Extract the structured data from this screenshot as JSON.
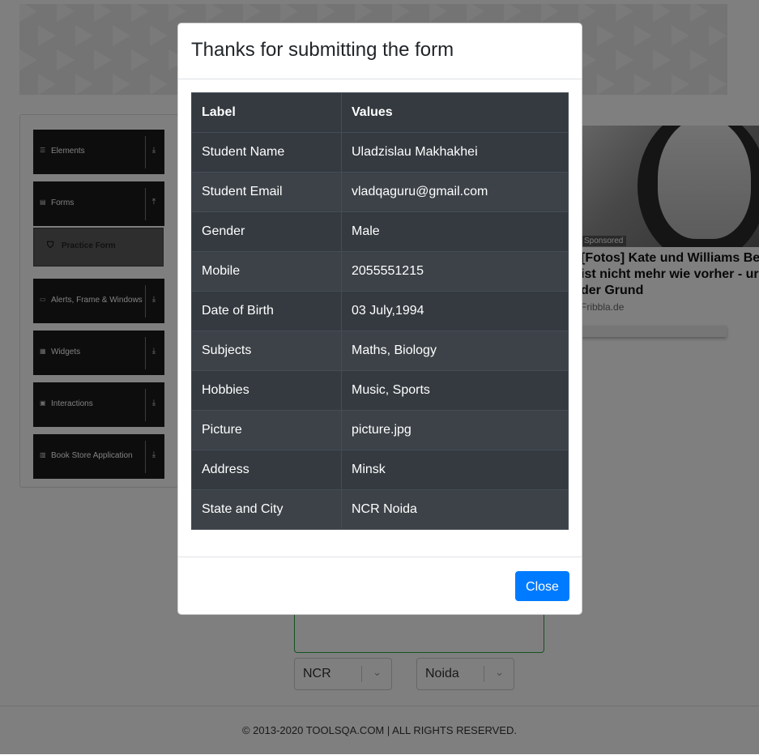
{
  "sidebar": {
    "groups": [
      {
        "label": "Elements",
        "icon": "list-icon"
      },
      {
        "label": "Forms",
        "icon": "document-icon"
      },
      {
        "label": "Alerts, Frame & Windows",
        "icon": "window-icon"
      },
      {
        "label": "Widgets",
        "icon": "grid-icon"
      },
      {
        "label": "Interactions",
        "icon": "interaction-icon"
      },
      {
        "label": "Book Store Application",
        "icon": "books-icon"
      }
    ],
    "active_item": {
      "label": "Practice Form",
      "icon": "html5-icon"
    }
  },
  "form": {
    "state_city_label": "State and City",
    "state_value": "NCR",
    "city_value": "Noida"
  },
  "ad": {
    "sponsored_label": "Sponsored",
    "title": "[Fotos] Kate und Williams Be ist nicht mehr wie vorher - ur der Grund",
    "title_lines": [
      "[Fotos] Kate und Williams Be",
      "ist nicht mehr wie vorher - ur",
      "der Grund"
    ],
    "source": "Fribbla.de"
  },
  "modal": {
    "title": "Thanks for submitting the form",
    "headers": [
      "Label",
      "Values"
    ],
    "rows": [
      [
        "Student Name",
        "Uladzislau Makhakhei"
      ],
      [
        "Student Email",
        "vladqaguru@gmail.com"
      ],
      [
        "Gender",
        "Male"
      ],
      [
        "Mobile",
        "2055551215"
      ],
      [
        "Date of Birth",
        "03 July,1994"
      ],
      [
        "Subjects",
        "Maths, Biology"
      ],
      [
        "Hobbies",
        "Music, Sports"
      ],
      [
        "Picture",
        "picture.jpg"
      ],
      [
        "Address",
        "Minsk"
      ],
      [
        "State and City",
        "NCR Noida"
      ]
    ],
    "close_label": "Close"
  },
  "footer": {
    "text": "© 2013-2020 TOOLSQA.COM | ALL RIGHTS RESERVED."
  },
  "colors": {
    "primary_button": "#007bff",
    "table_dark": "#343a40",
    "sidebar_group": "#1a1a1a"
  }
}
